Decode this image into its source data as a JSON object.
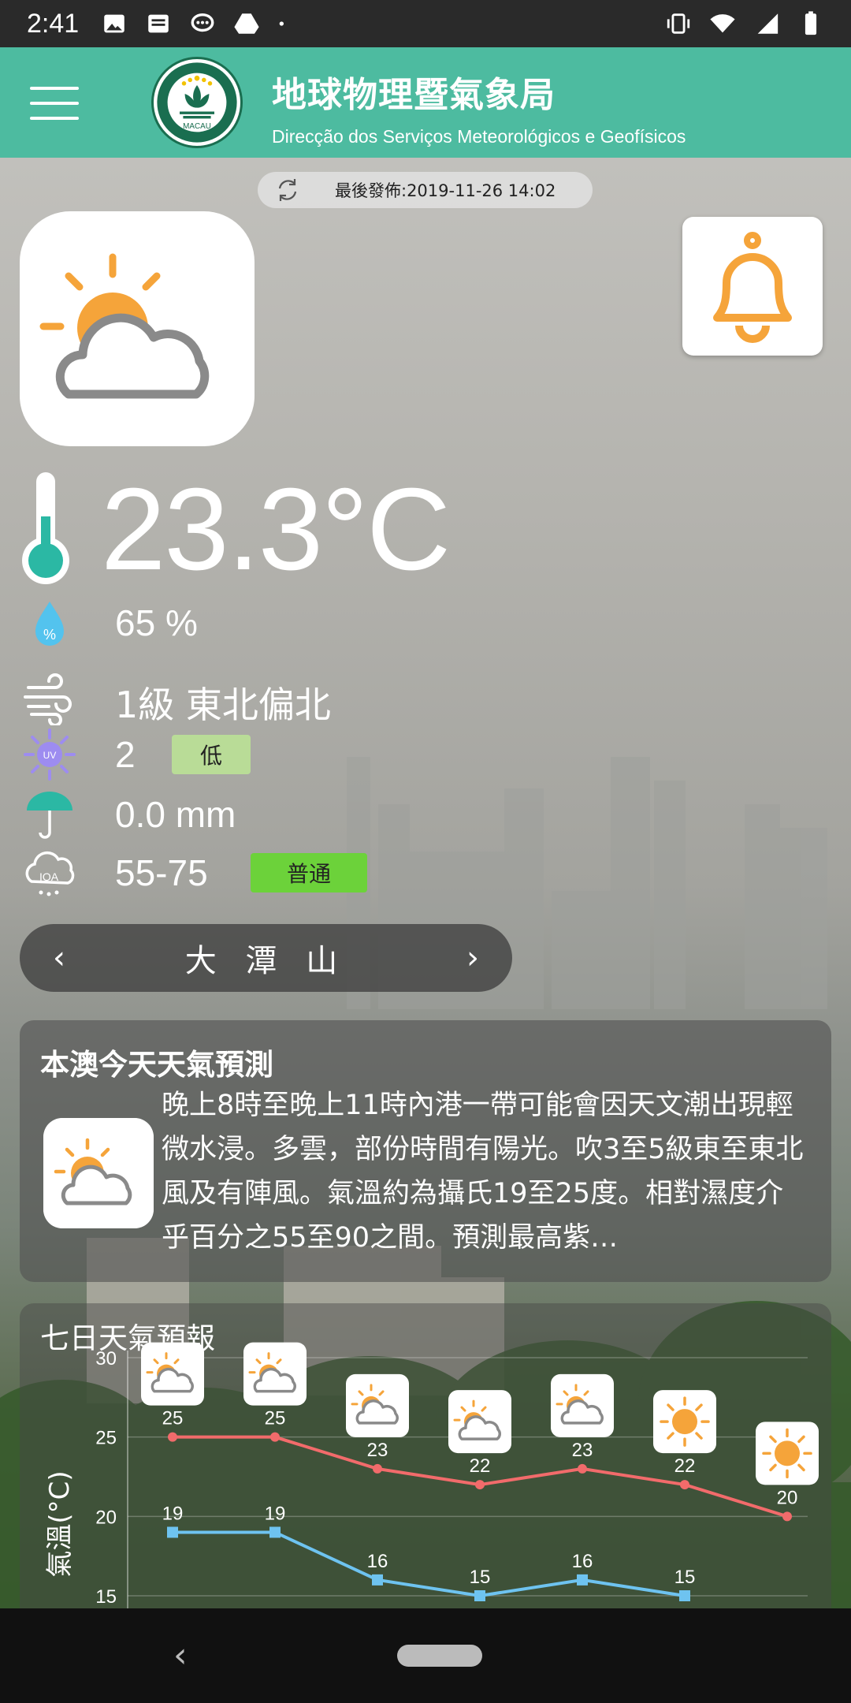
{
  "status_bar": {
    "time": "2:41"
  },
  "header": {
    "title": "地球物理暨氣象局",
    "subtitle": "Direcção dos Serviços Meteorológicos e Geofísicos",
    "emblem_text": "MACAU",
    "menu_icon": "menu-icon",
    "accent_color": "#4dbba0"
  },
  "update": {
    "label": "最後發佈:2019-11-26 14:02",
    "icon": "refresh-icon"
  },
  "current": {
    "weather_icon": "partly-cloudy-icon",
    "temperature": "23.3°C",
    "humidity": "65 %",
    "wind": "1級 東北偏北",
    "uv_value": "2",
    "uv_level": "低",
    "uv_badge_color": "#b9dc97",
    "rainfall": "0.0 mm",
    "aqi_value": "55-75",
    "aqi_level": "普通",
    "aqi_badge_color": "#6cd23a"
  },
  "station": {
    "name": "大 潭 山",
    "prev": "‹",
    "next": "›"
  },
  "forecast": {
    "title": "本澳今天天氣預測",
    "text": "晚上8時至晚上11時內港一帶可能會因天文潮出現輕微水浸。多雲，部份時間有陽光。吹3至5級東至東北風及有陣風。氣溫約為攝氏19至25度。相對濕度介乎百分之55至90之間。預測最高紫…"
  },
  "seven_day": {
    "title": "七日天氣預報"
  },
  "chart_data": {
    "type": "line",
    "ylabel": "氣溫(°C)",
    "ylim": [
      15,
      30
    ],
    "yticks": [
      "30",
      "25",
      "20",
      "15"
    ],
    "icons": [
      "partly-cloudy-icon",
      "partly-cloudy-icon",
      "partly-cloudy-icon",
      "partly-cloudy-icon",
      "partly-cloudy-icon",
      "sunny-icon",
      "sunny-icon"
    ],
    "series": [
      {
        "color": "#f26b6b",
        "values": [
          25,
          25,
          23,
          22,
          23,
          22,
          20
        ]
      },
      {
        "color": "#6ec3f0",
        "values": [
          19,
          19,
          16,
          15,
          16,
          15
        ]
      }
    ]
  }
}
